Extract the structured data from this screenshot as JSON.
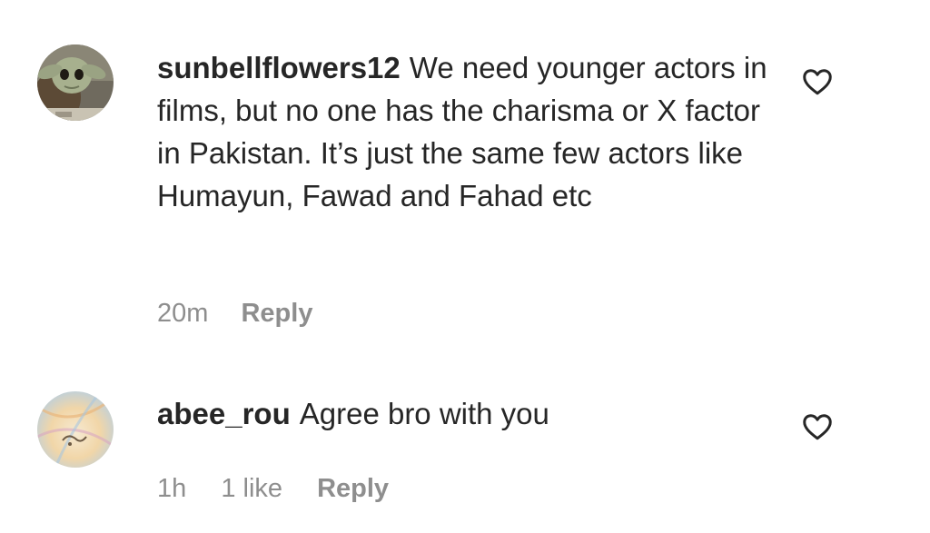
{
  "comments": [
    {
      "username": "sunbellflowers12",
      "text": "We need younger actors in films, but no one has the charisma or X factor in Pakistan. It’s just the same few actors like Humayun, Fawad and Fahad etc",
      "time": "20m",
      "likes": "",
      "reply_label": "Reply",
      "avatar_icon": "baby-yoda-avatar",
      "like_icon": "heart-outline-icon"
    },
    {
      "username": "abee_rou",
      "text": "Agree bro with you",
      "time": "1h",
      "likes": "1 like",
      "reply_label": "Reply",
      "avatar_icon": "calligraphy-avatar",
      "like_icon": "heart-outline-icon"
    }
  ],
  "colors": {
    "text": "#262626",
    "meta": "#8e8e8e",
    "background": "#ffffff"
  }
}
